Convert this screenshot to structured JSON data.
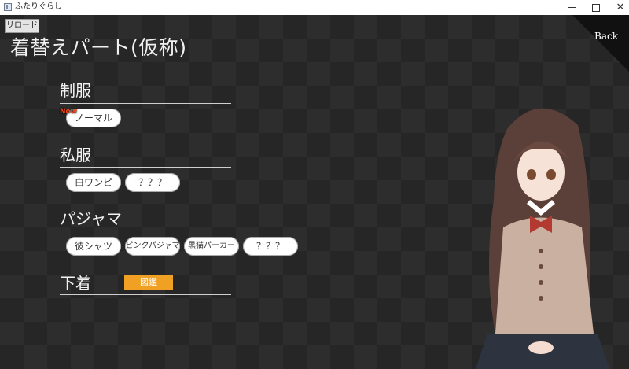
{
  "window": {
    "title": "ふたりぐらし",
    "controls": {
      "minimize": "",
      "maximize": "",
      "close": "✕"
    }
  },
  "toolbar": {
    "reload_label": "リロード"
  },
  "page": {
    "title": "着替えパート(仮称)",
    "back_label": "Back"
  },
  "sections": [
    {
      "title": "制服",
      "items": [
        {
          "label": "ノーマル",
          "current": true
        }
      ]
    },
    {
      "title": "私服",
      "items": [
        {
          "label": "白ワンピ"
        },
        {
          "label": "？？？"
        }
      ]
    },
    {
      "title": "パジャマ",
      "items": [
        {
          "label": "彼シャツ"
        },
        {
          "label": "ピンクパジャマ"
        },
        {
          "label": "黒猫パーカー"
        },
        {
          "label": "？？？"
        }
      ]
    },
    {
      "title": "下着",
      "gallery_label": "図鑑"
    }
  ],
  "now_badge": "Now",
  "colors": {
    "background": "#262626",
    "gallery_button": "#f0a023",
    "now_badge": "#ff4a1a"
  }
}
